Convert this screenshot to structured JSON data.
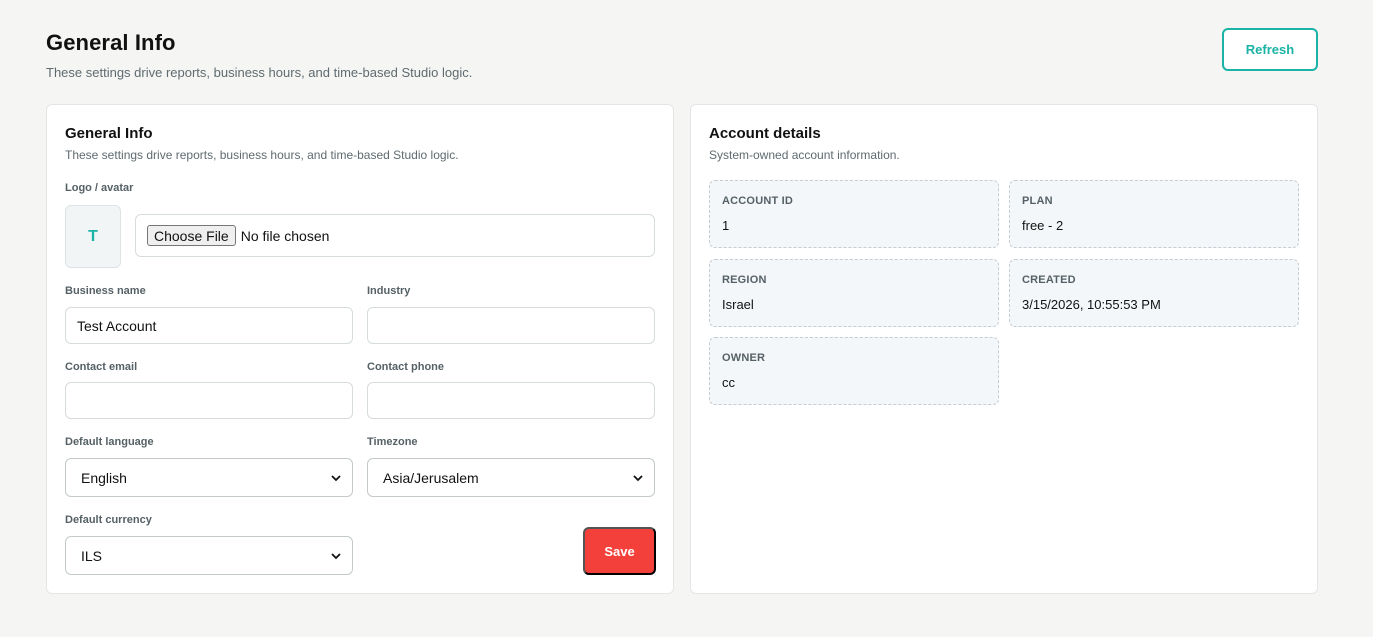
{
  "header": {
    "title": "General Info",
    "subtitle": "These settings drive reports, business hours, and time-based Studio logic.",
    "refresh_label": "Refresh"
  },
  "general_card": {
    "title": "General Info",
    "subtitle": "These settings drive reports, business hours, and time-based Studio logic.",
    "logo_label": "Logo / avatar",
    "avatar_initial": "T",
    "file_button_label": "Choose File",
    "file_status": "No file chosen",
    "business_name_label": "Business name",
    "business_name_value": "Test Account",
    "industry_label": "Industry",
    "industry_value": "",
    "contact_email_label": "Contact email",
    "contact_email_value": "",
    "contact_phone_label": "Contact phone",
    "contact_phone_value": "",
    "default_language_label": "Default language",
    "default_language_value": "English",
    "timezone_label": "Timezone",
    "timezone_value": "Asia/Jerusalem",
    "default_currency_label": "Default currency",
    "default_currency_value": "ILS",
    "save_label": "Save"
  },
  "account_card": {
    "title": "Account details",
    "subtitle": "System-owned account information.",
    "fields": [
      {
        "label": "ACCOUNT ID",
        "value": "1"
      },
      {
        "label": "PLAN",
        "value": "free - 2"
      },
      {
        "label": "REGION",
        "value": "Israel"
      },
      {
        "label": "CREATED",
        "value": "3/15/2026, 10:55:53 PM"
      },
      {
        "label": "OWNER",
        "value": "cc"
      }
    ]
  },
  "colors": {
    "accent": "#1bb3a6",
    "danger": "#f4403a",
    "background": "#f5f5f3"
  },
  "icons": {
    "select_chevron": "chevron-down-icon"
  }
}
